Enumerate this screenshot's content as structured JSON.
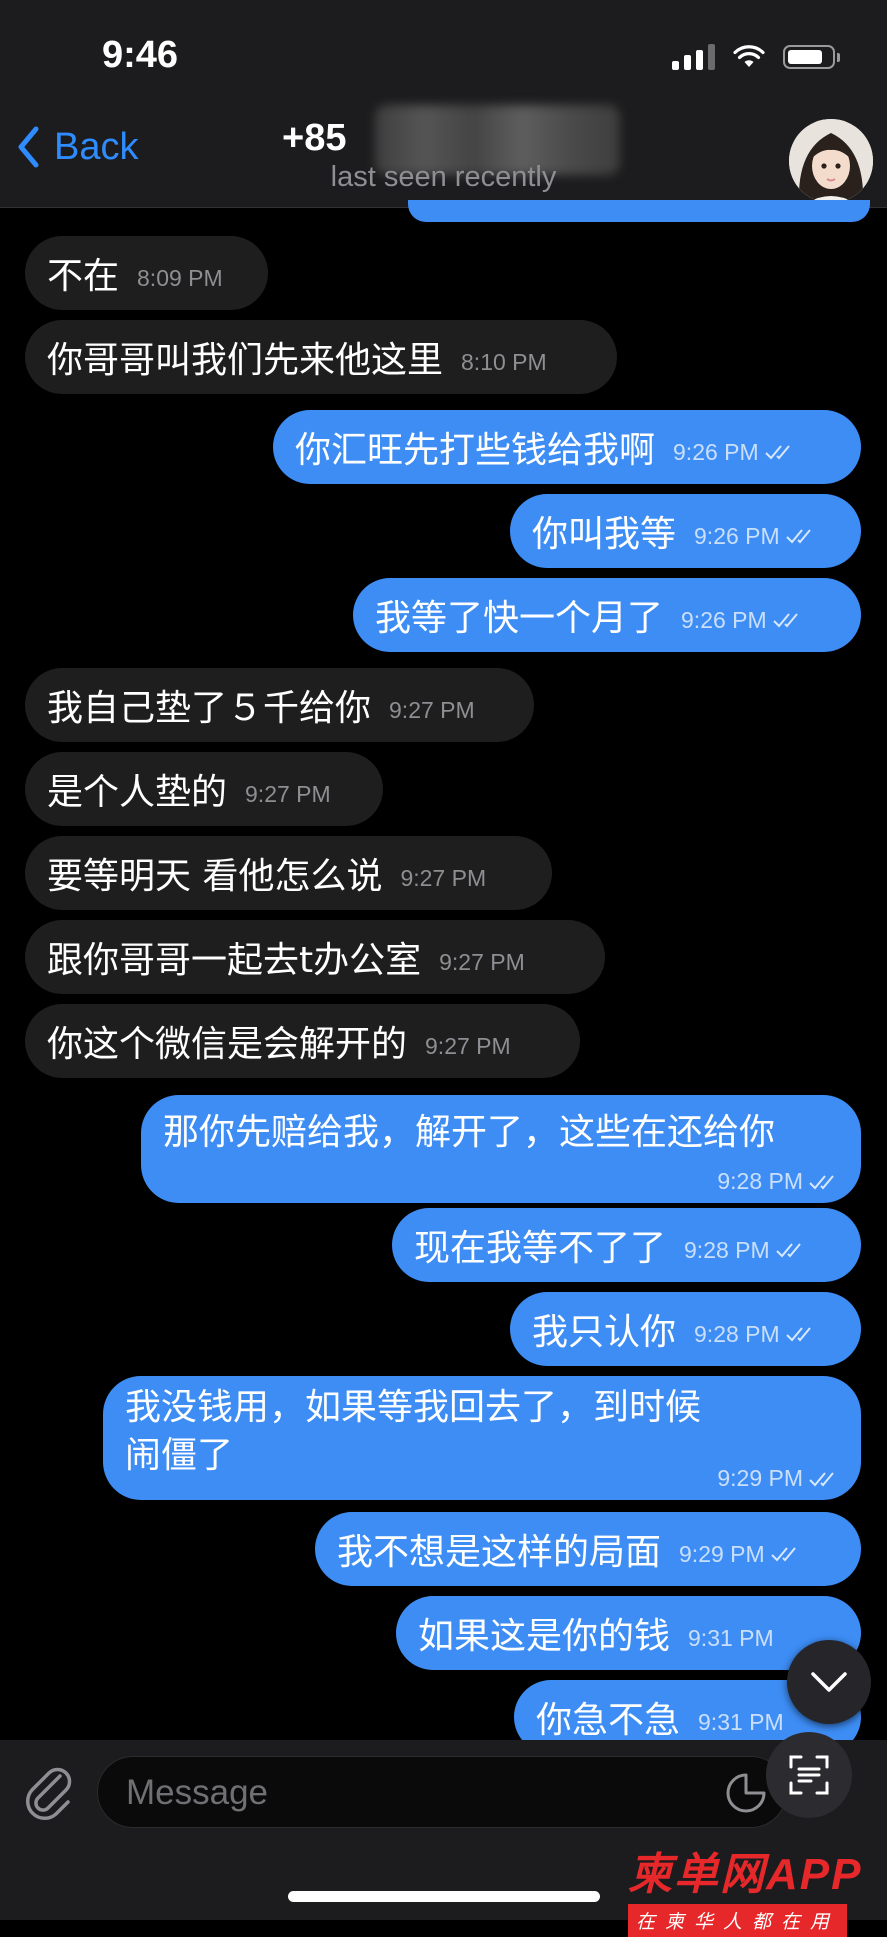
{
  "status_bar": {
    "time": "9:46"
  },
  "header": {
    "back_label": "Back",
    "title": "+85",
    "subtitle": "last seen recently"
  },
  "messages": [
    {
      "dir": "in",
      "text": "不在",
      "time": "8:09 PM"
    },
    {
      "dir": "in",
      "text": "你哥哥叫我们先来他这里",
      "time": "8:10 PM"
    },
    {
      "dir": "out",
      "text": "你汇旺先打些钱给我啊",
      "time": "9:26 PM"
    },
    {
      "dir": "out",
      "text": "你叫我等",
      "time": "9:26 PM"
    },
    {
      "dir": "out",
      "text": "我等了快一个月了",
      "time": "9:26 PM"
    },
    {
      "dir": "in",
      "text": "我自己垫了５千给你",
      "time": "9:27 PM"
    },
    {
      "dir": "in",
      "text": "是个人垫的",
      "time": "9:27 PM"
    },
    {
      "dir": "in",
      "text": "要等明天 看他怎么说",
      "time": "9:27 PM"
    },
    {
      "dir": "in",
      "text": "跟你哥哥一起去t办公室",
      "time": "9:27 PM"
    },
    {
      "dir": "in",
      "text": "你这个微信是会解开的",
      "time": "9:27 PM"
    },
    {
      "dir": "out",
      "text": "那你先赔给我，解开了，这些在还给你",
      "time": "9:28 PM"
    },
    {
      "dir": "out",
      "text": "现在我等不了了",
      "time": "9:28 PM"
    },
    {
      "dir": "out",
      "text": "我只认你",
      "time": "9:28 PM"
    },
    {
      "dir": "out",
      "text": "我没钱用，如果等我回去了，到时候闹僵了",
      "time": "9:29 PM"
    },
    {
      "dir": "out",
      "text": "我不想是这样的局面",
      "time": "9:29 PM"
    },
    {
      "dir": "out",
      "text": "如果这是你的钱",
      "time": "9:31 PM"
    },
    {
      "dir": "out",
      "text": "你急不急",
      "time": "9:31 PM"
    }
  ],
  "input": {
    "placeholder": "Message"
  },
  "watermark": {
    "brand": "柬单网APP",
    "tagline": "在柬华人都在用"
  }
}
